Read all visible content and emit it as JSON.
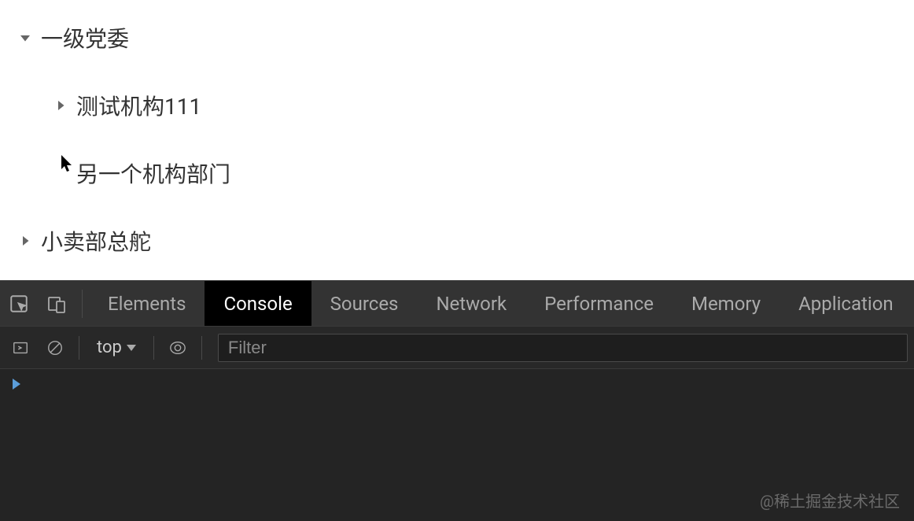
{
  "tree": {
    "root1": {
      "label": "一级党委",
      "expanded": true,
      "children": {
        "c1": {
          "label": "测试机构111",
          "expanded": false,
          "hasChildren": true
        },
        "c2": {
          "label": "另一个机构部门",
          "expanded": false,
          "hasChildren": false
        }
      }
    },
    "root2": {
      "label": "小卖部总舵",
      "expanded": false
    }
  },
  "devtools": {
    "tabs": {
      "elements": "Elements",
      "console": "Console",
      "sources": "Sources",
      "network": "Network",
      "performance": "Performance",
      "memory": "Memory",
      "application": "Application"
    },
    "activeTab": "Console",
    "context": "top",
    "filterPlaceholder": "Filter"
  },
  "watermark": "@稀土掘金技术社区"
}
